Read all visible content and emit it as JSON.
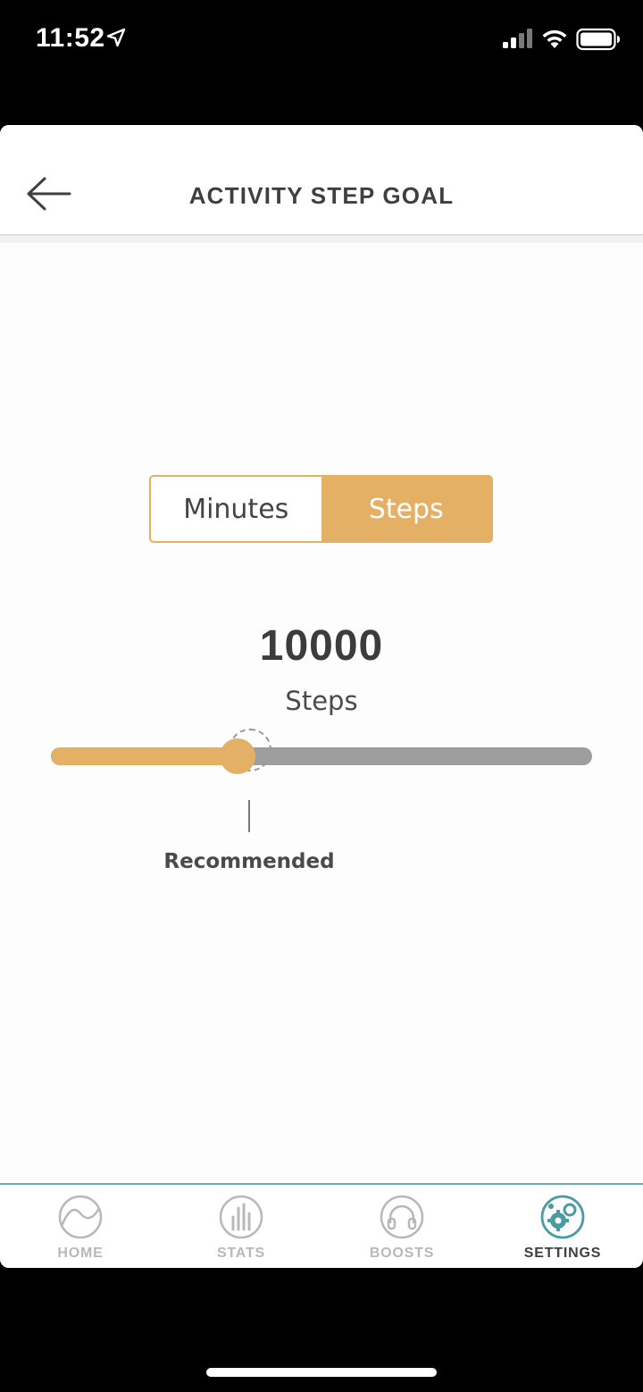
{
  "status_bar": {
    "time": "11:52",
    "icons": [
      "location-arrow-icon",
      "signal-icon",
      "wifi-icon",
      "battery-icon"
    ]
  },
  "header": {
    "title": "ACTIVITY STEP GOAL",
    "back_icon": "back-arrow-icon"
  },
  "segment": {
    "options": [
      {
        "label": "Minutes",
        "selected": false
      },
      {
        "label": "Steps",
        "selected": true
      }
    ]
  },
  "goal": {
    "value": "10000",
    "unit": "Steps"
  },
  "slider": {
    "fraction": 0.345,
    "recommended_label": "Recommended"
  },
  "tabbar": {
    "tabs": [
      {
        "label": "HOME",
        "icon": "home-wave-icon",
        "active": false
      },
      {
        "label": "STATS",
        "icon": "stats-bars-icon",
        "active": false
      },
      {
        "label": "BOOSTS",
        "icon": "headphones-icon",
        "active": false
      },
      {
        "label": "SETTINGS",
        "icon": "settings-gears-icon",
        "active": true
      }
    ]
  },
  "colors": {
    "accent": "#e3b066",
    "track": "#9e9e9e",
    "active_tab_icon": "#4a9ba3",
    "tab_divider": "#6fa9ae",
    "inactive_tab": "#b8b8b8"
  }
}
